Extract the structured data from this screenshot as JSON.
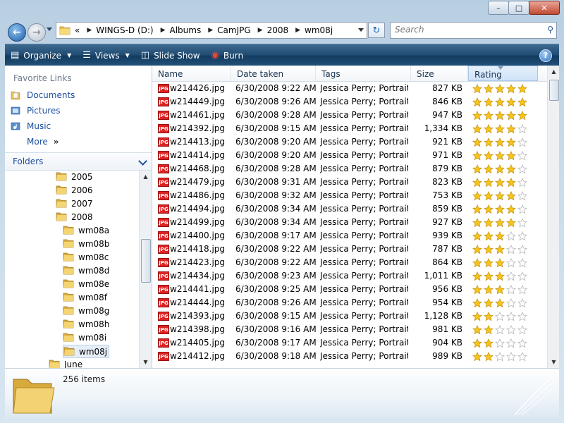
{
  "window": {
    "buttons": {
      "minimize": "–",
      "maximize": "□",
      "close": "✕"
    }
  },
  "address": {
    "overflow": "«",
    "crumbs": [
      "WINGS-D (D:)",
      "Albums",
      "CamJPG",
      "2008",
      "wm08j"
    ]
  },
  "search": {
    "placeholder": "Search"
  },
  "toolbar": {
    "organize": "Organize",
    "views": "Views",
    "slideshow": "Slide Show",
    "burn": "Burn",
    "help": "?"
  },
  "nav": {
    "favorites_title": "Favorite Links",
    "favorites": [
      "Documents",
      "Pictures",
      "Music"
    ],
    "more": "More",
    "more_chevron": "»",
    "folders_title": "Folders",
    "tree": [
      {
        "label": "2005",
        "level": 1
      },
      {
        "label": "2006",
        "level": 1
      },
      {
        "label": "2007",
        "level": 1
      },
      {
        "label": "2008",
        "level": 1
      },
      {
        "label": "wm08a",
        "level": 2
      },
      {
        "label": "wm08b",
        "level": 2
      },
      {
        "label": "wm08c",
        "level": 2
      },
      {
        "label": "wm08d",
        "level": 2
      },
      {
        "label": "wm08e",
        "level": 2
      },
      {
        "label": "wm08f",
        "level": 2
      },
      {
        "label": "wm08g",
        "level": 2
      },
      {
        "label": "wm08h",
        "level": 2
      },
      {
        "label": "wm08i",
        "level": 2
      },
      {
        "label": "wm08j",
        "level": 2,
        "selected": true
      },
      {
        "label": "June",
        "level": 0
      }
    ]
  },
  "files": {
    "columns": [
      "Name",
      "Date taken",
      "Tags",
      "Size",
      "Rating"
    ],
    "file_icon_label": "JPG",
    "rows": [
      {
        "name": "w214426.jpg",
        "date": "6/30/2008 9:22 AM",
        "tags": "Jessica Perry; Portraits",
        "size": "827 KB",
        "rating": 5
      },
      {
        "name": "w214449.jpg",
        "date": "6/30/2008 9:26 AM",
        "tags": "Jessica Perry; Portraits",
        "size": "846 KB",
        "rating": 5
      },
      {
        "name": "w214461.jpg",
        "date": "6/30/2008 9:28 AM",
        "tags": "Jessica Perry; Portraits",
        "size": "947 KB",
        "rating": 5
      },
      {
        "name": "w214392.jpg",
        "date": "6/30/2008 9:15 AM",
        "tags": "Jessica Perry; Portraits",
        "size": "1,334 KB",
        "rating": 4
      },
      {
        "name": "w214413.jpg",
        "date": "6/30/2008 9:20 AM",
        "tags": "Jessica Perry; Portraits",
        "size": "921 KB",
        "rating": 4
      },
      {
        "name": "w214414.jpg",
        "date": "6/30/2008 9:20 AM",
        "tags": "Jessica Perry; Portraits",
        "size": "971 KB",
        "rating": 4
      },
      {
        "name": "w214468.jpg",
        "date": "6/30/2008 9:28 AM",
        "tags": "Jessica Perry; Portraits",
        "size": "879 KB",
        "rating": 4
      },
      {
        "name": "w214479.jpg",
        "date": "6/30/2008 9:31 AM",
        "tags": "Jessica Perry; Portraits",
        "size": "823 KB",
        "rating": 4
      },
      {
        "name": "w214486.jpg",
        "date": "6/30/2008 9:32 AM",
        "tags": "Jessica Perry; Portraits",
        "size": "753 KB",
        "rating": 4
      },
      {
        "name": "w214494.jpg",
        "date": "6/30/2008 9:34 AM",
        "tags": "Jessica Perry; Portraits",
        "size": "859 KB",
        "rating": 4
      },
      {
        "name": "w214499.jpg",
        "date": "6/30/2008 9:34 AM",
        "tags": "Jessica Perry; Portraits",
        "size": "927 KB",
        "rating": 4
      },
      {
        "name": "w214400.jpg",
        "date": "6/30/2008 9:17 AM",
        "tags": "Jessica Perry; Portraits",
        "size": "939 KB",
        "rating": 3
      },
      {
        "name": "w214418.jpg",
        "date": "6/30/2008 9:22 AM",
        "tags": "Jessica Perry; Portraits",
        "size": "787 KB",
        "rating": 3
      },
      {
        "name": "w214423.jpg",
        "date": "6/30/2008 9:22 AM",
        "tags": "Jessica Perry; Portraits",
        "size": "864 KB",
        "rating": 3
      },
      {
        "name": "w214434.jpg",
        "date": "6/30/2008 9:23 AM",
        "tags": "Jessica Perry; Portraits",
        "size": "1,011 KB",
        "rating": 3
      },
      {
        "name": "w214441.jpg",
        "date": "6/30/2008 9:25 AM",
        "tags": "Jessica Perry; Portraits",
        "size": "956 KB",
        "rating": 3
      },
      {
        "name": "w214444.jpg",
        "date": "6/30/2008 9:26 AM",
        "tags": "Jessica Perry; Portraits",
        "size": "954 KB",
        "rating": 3
      },
      {
        "name": "w214393.jpg",
        "date": "6/30/2008 9:15 AM",
        "tags": "Jessica Perry; Portraits",
        "size": "1,128 KB",
        "rating": 2
      },
      {
        "name": "w214398.jpg",
        "date": "6/30/2008 9:16 AM",
        "tags": "Jessica Perry; Portraits",
        "size": "981 KB",
        "rating": 2
      },
      {
        "name": "w214405.jpg",
        "date": "6/30/2008 9:17 AM",
        "tags": "Jessica Perry; Portraits",
        "size": "904 KB",
        "rating": 2
      },
      {
        "name": "w214412.jpg",
        "date": "6/30/2008 9:18 AM",
        "tags": "Jessica Perry; Portraits",
        "size": "989 KB",
        "rating": 2
      }
    ]
  },
  "details": {
    "item_count": "256 items"
  },
  "colors": {
    "accent": "#1e4fa0",
    "command_bar": "#1f4b72",
    "star_filled": "#f5c518",
    "star_empty": "#ffffff"
  }
}
